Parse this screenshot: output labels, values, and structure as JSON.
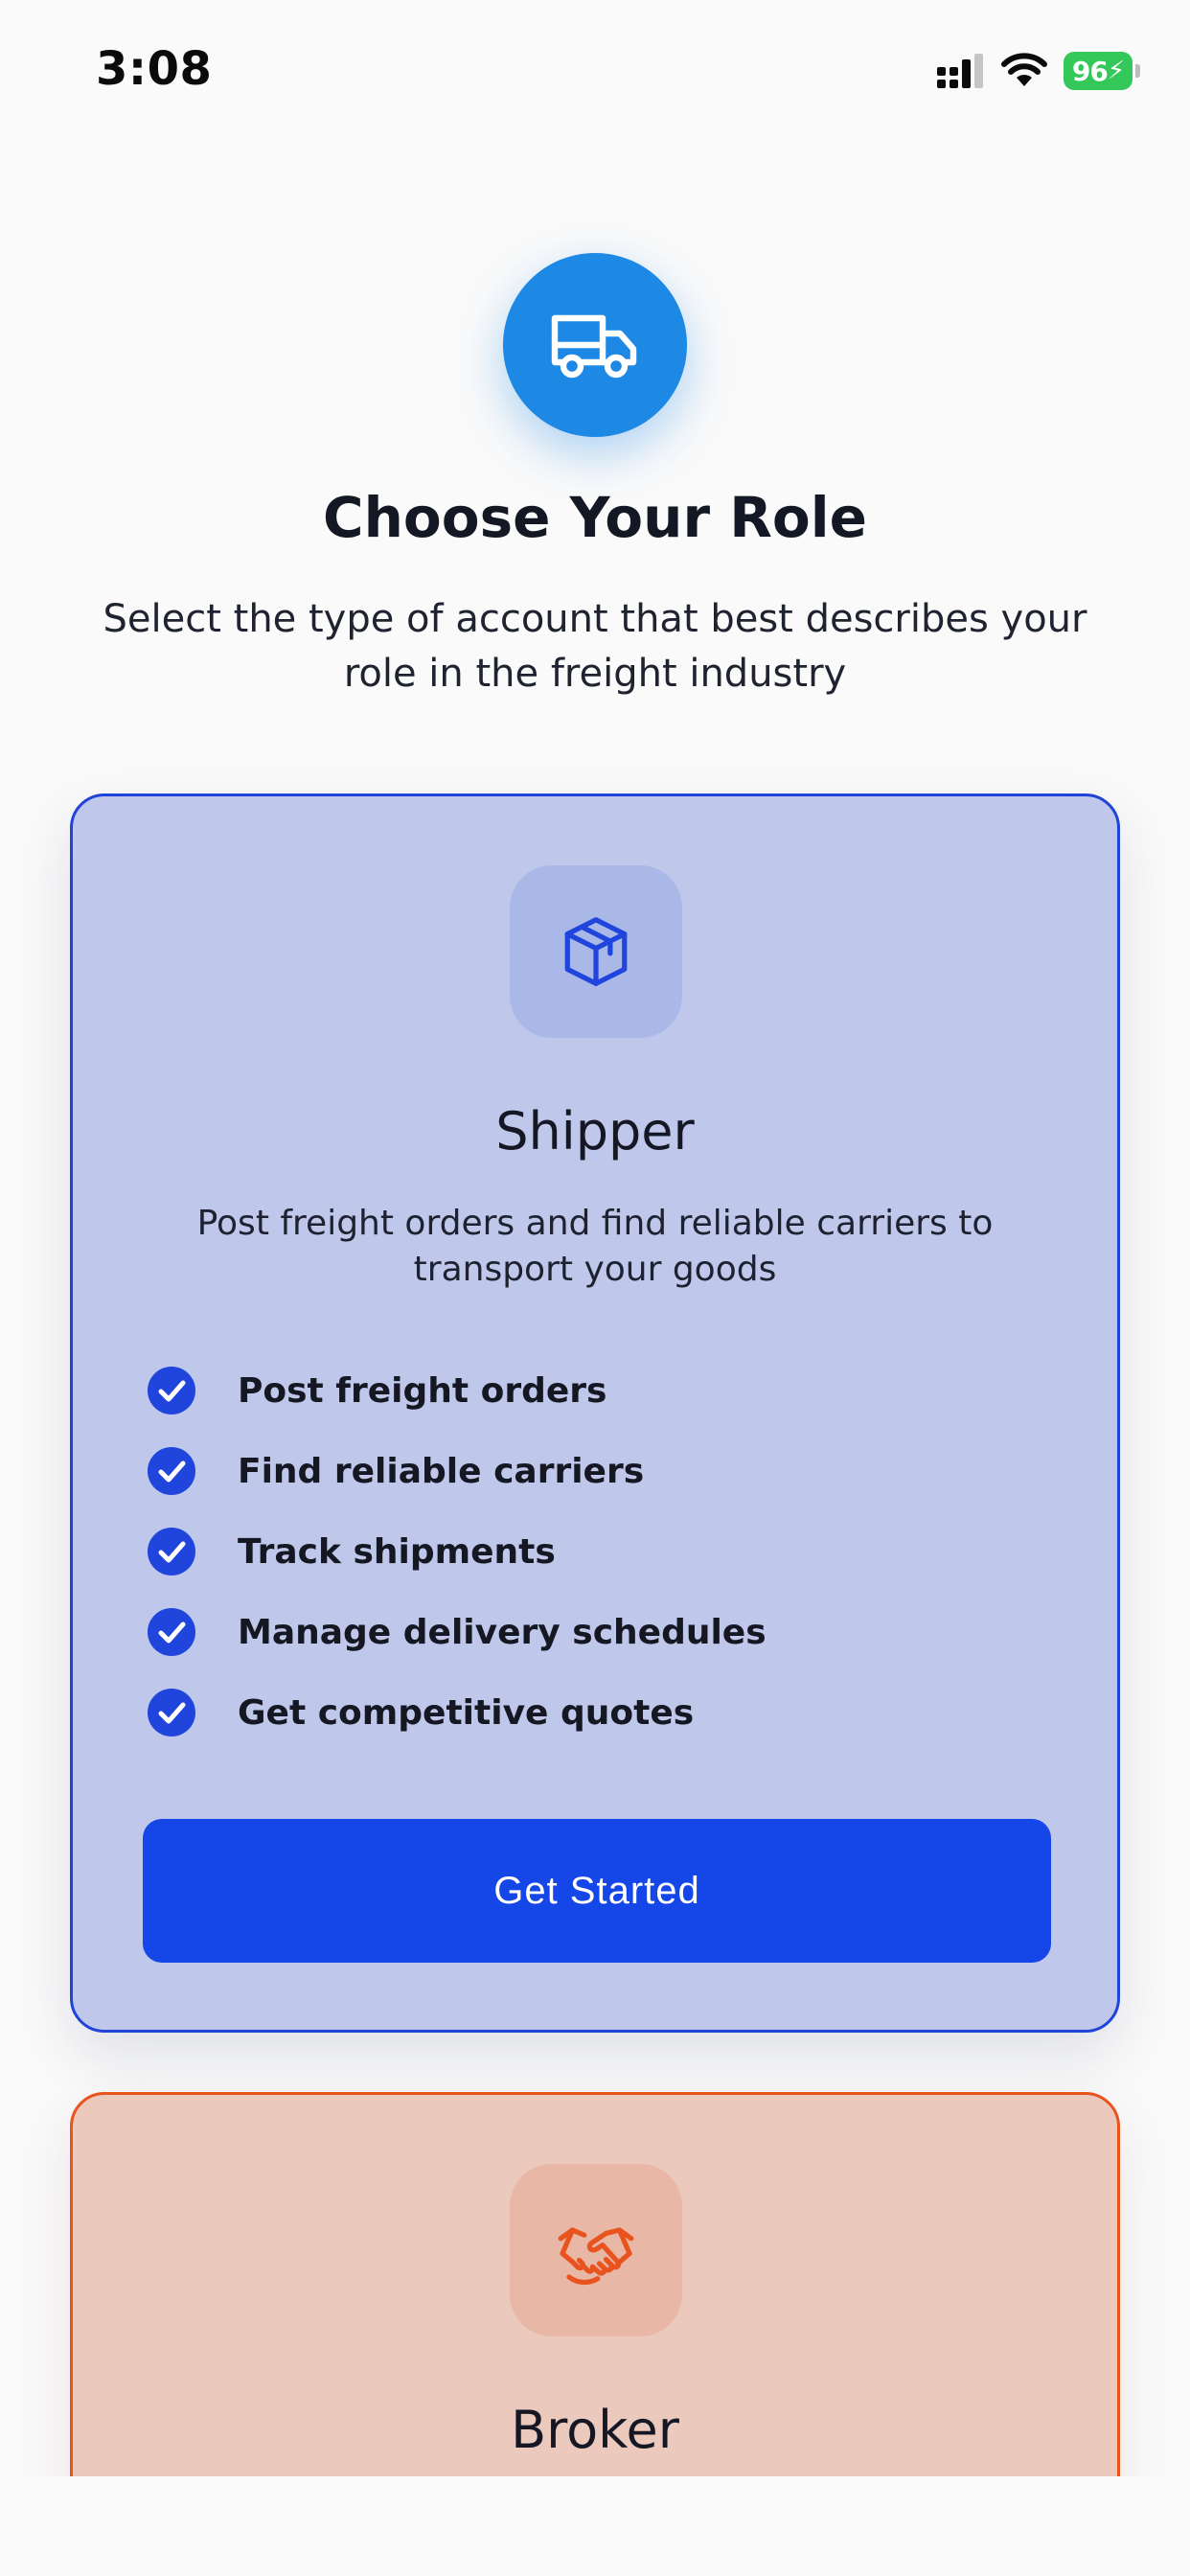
{
  "status_bar": {
    "time": "3:08",
    "battery": "96"
  },
  "header": {
    "title": "Choose Your Role",
    "subtitle": "Select the type of account that best describes your role in the freight industry"
  },
  "cards": [
    {
      "title": "Shipper",
      "description": "Post freight orders and find reliable carriers to transport your goods",
      "features": [
        "Post freight orders",
        "Find reliable carriers",
        "Track shipments",
        "Manage delivery schedules",
        "Get competitive quotes"
      ],
      "button_label": "Get Started"
    },
    {
      "title": "Broker"
    }
  ],
  "colors": {
    "background": "#fafafa",
    "hero_icon": "#1e88e5",
    "shipper_accent": "#1546e8",
    "shipper_card": "#bfc8ea",
    "broker_accent": "#e8531e",
    "broker_card": "#ebcabd",
    "battery_green": "#34c759"
  },
  "icons": {
    "hero": "truck-icon",
    "shipper": "package-icon",
    "broker": "handshake-icon",
    "feature": "check-circle-icon"
  }
}
